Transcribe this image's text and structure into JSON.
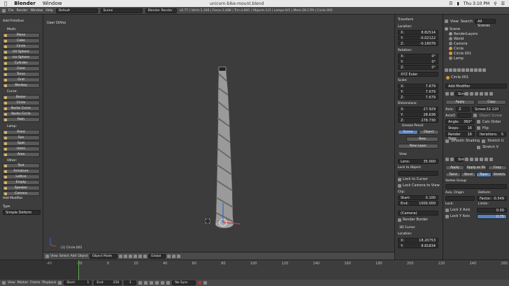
{
  "mac_menu": {
    "apple": "",
    "app": "Blender",
    "window": "Window",
    "right_time": "Thu 3:10 PM"
  },
  "info_bar": {
    "menus": [
      "File",
      "Render",
      "Window",
      "Help"
    ],
    "layout": "Default",
    "scene": "Scene",
    "engine": "Blender Render",
    "stats": "v2.77 | Verts:1,346 | Faces:2,688 | Tris:4,800 | Objects:1/3 | Lamps:0/1 | Mem:28.17M | Circle.001",
    "title": "unicorn-bike-mount.blend"
  },
  "tools": {
    "header": "Add Primitive",
    "mesh_label": "Mesh:",
    "mesh": [
      "Plane",
      "Cube",
      "Circle",
      "UV Sphere",
      "Ico Sphere",
      "Cylinder",
      "Cone",
      "Torus"
    ],
    "extra": [
      "Grid",
      "Monkey"
    ],
    "curve_label": "Curve:",
    "curve": [
      "Bezier",
      "Circle",
      "Nurbs Curve",
      "Nurbs Circle",
      "Path"
    ],
    "lamp_label": "Lamp:",
    "lamp": [
      "Point",
      "Sun",
      "Spot",
      "Hemi",
      "Area"
    ],
    "other_label": "Other:",
    "other": [
      "Text",
      "Armature",
      "Lattice",
      "Empty",
      "Speaker",
      "Camera"
    ],
    "modifier_header": "Add Modifier",
    "type_label": "Type",
    "type_value": "Simple Deform"
  },
  "viewport": {
    "view_label": "User Ortho",
    "object_label": "(1) Circle.001"
  },
  "viewport_header": {
    "menus": [
      "View",
      "Select",
      "Add",
      "Object"
    ],
    "mode": "Object Mode",
    "pivot": "Global"
  },
  "properties": {
    "transform": "Transform",
    "location_label": "Location:",
    "location": [
      {
        "axis": "X:",
        "value": "8.82514"
      },
      {
        "axis": "Y:",
        "value": "-0.02122"
      },
      {
        "axis": "Z:",
        "value": "-0.18076"
      }
    ],
    "rotation_label": "Rotation:",
    "rotation": [
      {
        "axis": "X:",
        "value": "0°"
      },
      {
        "axis": "Y:",
        "value": "0°"
      },
      {
        "axis": "Z:",
        "value": "0°"
      }
    ],
    "rotation_mode": "XYZ Euler",
    "scale_label": "Scale:",
    "scale": [
      {
        "axis": "X:",
        "value": "7.679"
      },
      {
        "axis": "Y:",
        "value": "7.679"
      },
      {
        "axis": "Z:",
        "value": "7.679"
      }
    ],
    "dimensions_label": "Dimensions:",
    "dimensions": [
      {
        "axis": "X:",
        "value": "27.929"
      },
      {
        "axis": "Y:",
        "value": "28.636"
      },
      {
        "axis": "Z:",
        "value": "278.730"
      }
    ],
    "grease_pencil": "Grease Pencil",
    "scene_btn": "Scene",
    "object_btn": "Object",
    "new_btn": "New",
    "new_layer": "New Layer",
    "view_header": "View",
    "lens_label": "Lens:",
    "lens_value": "35.000",
    "lock_object": "Lock to Object:",
    "lock_cursor": "Lock to Cursor",
    "lock_camera": "Lock Camera to View",
    "clip_label": "Clip:",
    "clip_start_label": "Start:",
    "clip_start": "0.100",
    "clip_end_label": "End:",
    "clip_end": "1000.000",
    "local_camera": "(Camera)",
    "render_border": "Render Border",
    "cursor_header": "3D Cursor",
    "cursor_location": "Location:",
    "cursor_x_label": "X:",
    "cursor_x": "18.20753",
    "cursor_y_label": "Y:",
    "cursor_y": "8.81834"
  },
  "outliner": {
    "tabs": [
      "View",
      "Search",
      "All Scenes"
    ],
    "items": [
      "Scene",
      "RenderLayers",
      "World",
      "Camera",
      "Circle",
      "Circle.001",
      "Lamp"
    ]
  },
  "modifiers": {
    "object_name": "Circle.001",
    "add_modifier": "Add Modifier",
    "mod1_name": "Scre",
    "apply": "Apply",
    "copy": "Copy",
    "axis_label": "Axis:",
    "axis_value": "Z",
    "screw_label": "Screw:",
    "screw_value": "32.120",
    "axis_obj_label": "AxisO",
    "obj_screw": "Object Screw",
    "angle_label": "Angle:",
    "angle_value": "360°",
    "calc_order": "Calc Order",
    "steps_label": "Steps:",
    "steps_value": "16",
    "flip": "Flip",
    "render_steps_label": "Render Step:",
    "render_steps_value": "16",
    "iterations_label": "Iterations:",
    "iterations_value": "5",
    "smooth": "Smooth Shading",
    "stretch_u": "Stretch U",
    "stretch_v": "Stretch V",
    "mod2_name": "Sim",
    "apply2": "Apply",
    "apply_shape": "Apply as Sh",
    "copy2": "Copy",
    "modes": [
      "Twist",
      "Bend",
      "Taper",
      "Stretch"
    ],
    "vertex_group": "Vertex Group:",
    "axis_origin": "Axis, Origin:",
    "deform": "Deform:",
    "factor_label": "Factor:",
    "factor_value": "-0.549",
    "limits": "Limits:",
    "lock_label": "Lock:",
    "lock_x": "Lock X Axis",
    "lock_y": "Lock Y Axis",
    "limit_a": "0.00",
    "limit_b": "0.75"
  },
  "timeline": {
    "menus": [
      "View",
      "Marker",
      "Frame",
      "Playback"
    ],
    "start_label": "Start:",
    "start": "1",
    "end_label": "End:",
    "end": "250",
    "current": "1",
    "sync": "No Sync",
    "ruler": [
      "-40",
      "-20",
      "0",
      "20",
      "40",
      "60",
      "80",
      "100",
      "120",
      "140",
      "160",
      "180",
      "200",
      "220",
      "240",
      "260"
    ]
  },
  "colors": {
    "accent": "#5680c2",
    "viewport_bg": "#3c3c3c",
    "panel_bg": "#3d3d3d"
  }
}
